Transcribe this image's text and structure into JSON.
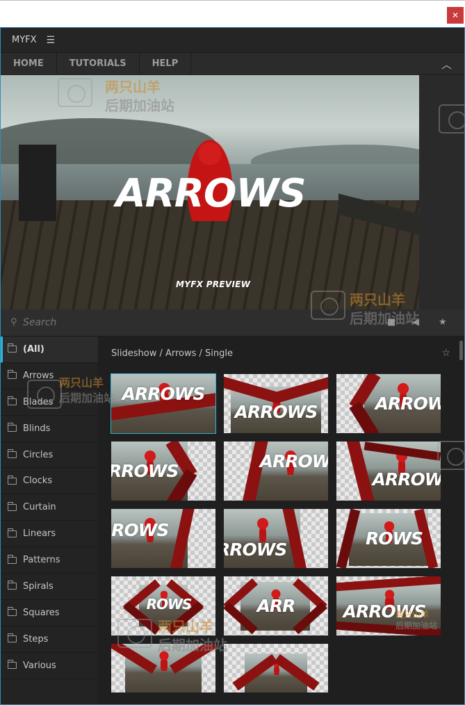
{
  "window": {
    "close_label": "✕"
  },
  "app": {
    "name": "MYFX",
    "menu_icon": "hamburger-icon"
  },
  "nav": {
    "tabs": [
      {
        "label": "HOME"
      },
      {
        "label": "TUTORIALS"
      },
      {
        "label": "HELP"
      }
    ],
    "collapse_icon": "chevron-up-icon"
  },
  "preview": {
    "title": "ARROWS",
    "subtitle": "MYFX PREVIEW"
  },
  "search": {
    "placeholder": "Search",
    "value": ""
  },
  "sidebar": {
    "items": [
      {
        "label": "(All)",
        "active": true
      },
      {
        "label": "Arrows"
      },
      {
        "label": "Blades"
      },
      {
        "label": "Blinds"
      },
      {
        "label": "Circles"
      },
      {
        "label": "Clocks"
      },
      {
        "label": "Curtain"
      },
      {
        "label": "Linears"
      },
      {
        "label": "Patterns"
      },
      {
        "label": "Spirals"
      },
      {
        "label": "Squares"
      },
      {
        "label": "Steps"
      },
      {
        "label": "Various"
      }
    ]
  },
  "content": {
    "breadcrumb": "Slideshow / Arrows / Single",
    "thumbnails": [
      {
        "word": "ARROWS",
        "selected": true
      },
      {
        "word": "ARROWS"
      },
      {
        "word": "ARROWS"
      },
      {
        "word": "ARROWS"
      },
      {
        "word": "ARROWS"
      },
      {
        "word": "ARROWS"
      },
      {
        "word": "ARROWS"
      },
      {
        "word": "ARROWS"
      },
      {
        "word": "ROWS"
      },
      {
        "word": "ROWS"
      },
      {
        "word": "ARR"
      },
      {
        "word": "ARROWS"
      },
      {
        "word": ""
      },
      {
        "word": ""
      }
    ]
  },
  "watermark": {
    "line1": "两只山羊",
    "line2": "后期加油站"
  },
  "colors": {
    "accent": "#2fb5d4",
    "close": "#c93a3a",
    "panel": "#232323"
  }
}
